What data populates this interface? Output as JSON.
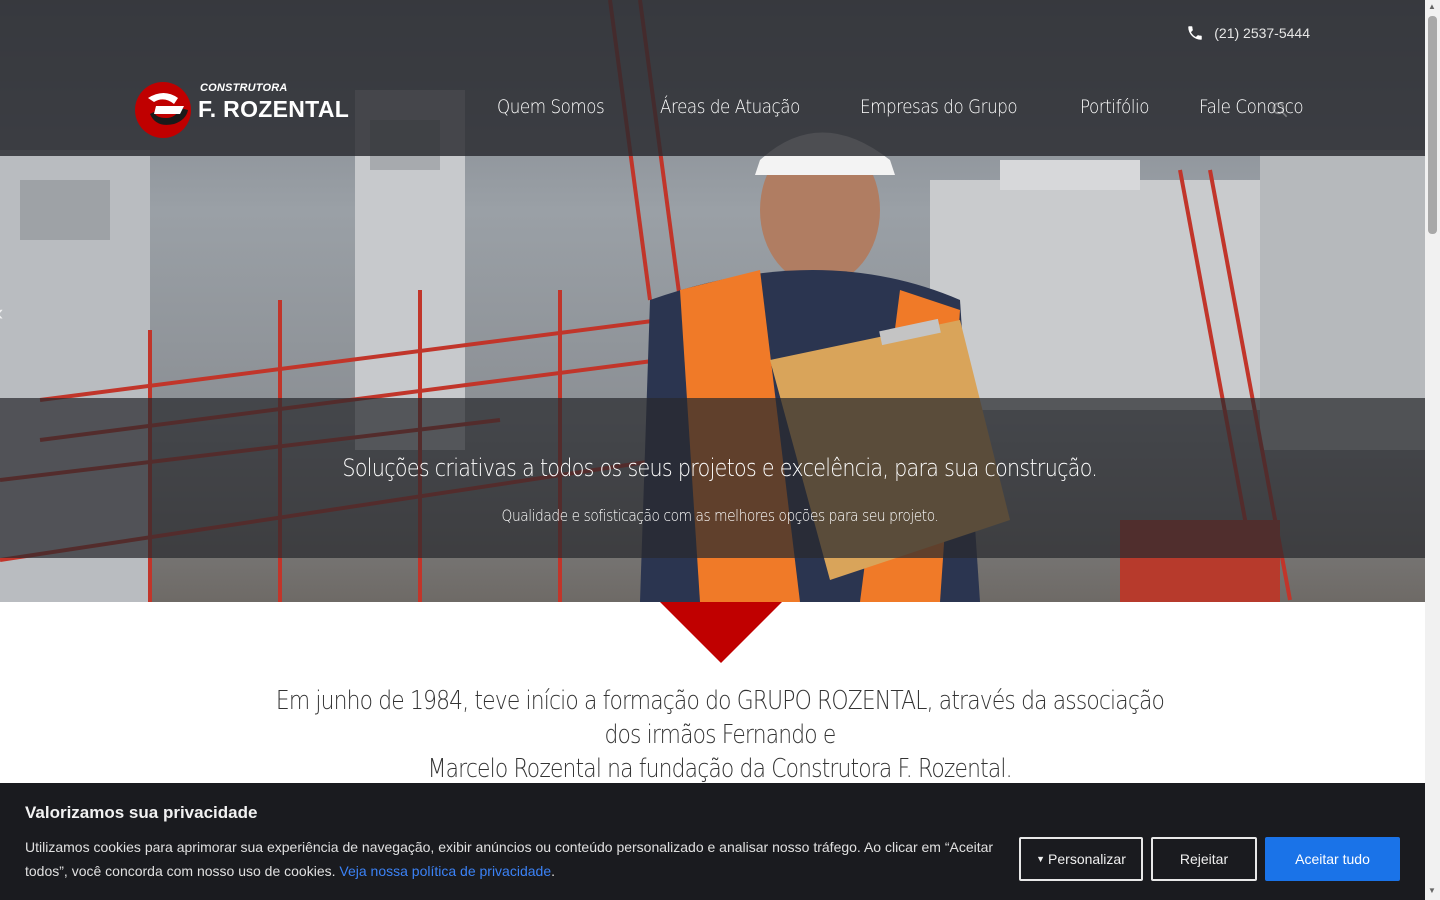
{
  "header": {
    "phone": "(21) 2537-5444",
    "logo_top": "CONSTRUTORA",
    "logo_main": "F. ROZENTAL",
    "nav": [
      {
        "label": "Quem Somos"
      },
      {
        "label": "Áreas de Atuação"
      },
      {
        "label": "Empresas do Grupo"
      },
      {
        "label": "Portifólio"
      },
      {
        "label": "Fale Conosco"
      }
    ]
  },
  "hero": {
    "title": "Soluções criativas a todos os seus projetos e excelência, para sua construção.",
    "subtitle": "Qualidade e sofisticação com as melhores opções para seu projeto."
  },
  "intro": {
    "line1": "Em junho de 1984, teve início a formação do GRUPO ROZENTAL, através da associação dos irmãos Fernando e",
    "line2": "Marcelo Rozental na fundação da Construtora F. Rozental."
  },
  "cookie": {
    "title": "Valorizamos sua privacidade",
    "text": "Utilizamos cookies para aprimorar sua experiência de navegação, exibir anúncios ou conteúdo personalizado e analisar nosso tráfego. Ao clicar em “Aceitar todos”, você concorda com nosso uso de cookies. ",
    "link": "Veja nossa política de privacidade",
    "after_link": ".",
    "customize": "Personalizar",
    "reject": "Rejeitar",
    "accept": "Aceitar tudo"
  },
  "colors": {
    "brand_red": "#c00000",
    "accept_blue": "#1a73e8",
    "link_blue": "#3b82f6"
  }
}
